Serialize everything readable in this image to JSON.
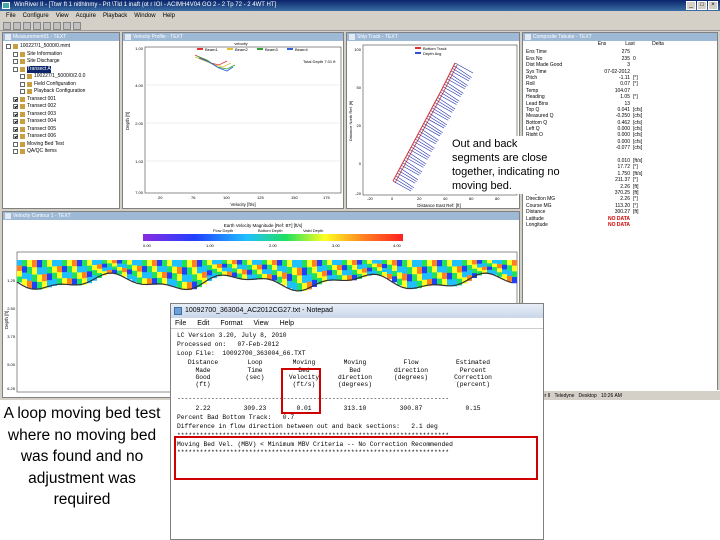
{
  "app": {
    "title": "WinRiver II - [Ttwr ft 1 nitlhlnmy - Prt \\Tld 1 inaft (ot r IOI - ACIMH4V04 GO 2 - 2 Tp 72 - 2 4WT HT]",
    "menu": [
      "File",
      "Configure",
      "View",
      "Acquire",
      "Playback",
      "Window",
      "Help"
    ]
  },
  "tree_pane": {
    "title": "Measurement01 - TEXT",
    "items": [
      {
        "label": "100227/1_5000/0.mmt",
        "checked": false
      },
      {
        "label": "Site Information",
        "checked": false
      },
      {
        "label": "Site Discharge",
        "checked": false
      },
      {
        "label": "Transect A",
        "checked": false,
        "selected": true
      },
      {
        "label": "100227/1_5000/0/2.0.0",
        "checked": false
      },
      {
        "label": "Field Configuration",
        "checked": false
      },
      {
        "label": "Playback Configuration",
        "checked": false
      },
      {
        "label": "Transect 001",
        "checked": true
      },
      {
        "label": "Transect 002",
        "checked": true
      },
      {
        "label": "Transect 003",
        "checked": true
      },
      {
        "label": "Transect 004",
        "checked": true
      },
      {
        "label": "Transect 005",
        "checked": true
      },
      {
        "label": "Transect 006",
        "checked": true
      },
      {
        "label": "Moving Bed Test",
        "checked": false
      },
      {
        "label": "QA/QC Items",
        "checked": false
      }
    ]
  },
  "velocity_pane": {
    "title": "Velocity Profile - TEXT",
    "legend_title": "velocity",
    "legend": [
      "Beam1",
      "Beam2",
      "Beam3",
      "Beam4"
    ],
    "depth_note": "Total Depth 7.01 ft",
    "ylabel": "Depth [ft]",
    "xlabel": "Velocity [ft/s]",
    "yticks": [
      "1.00",
      "4.00",
      "2.00",
      "1.03",
      "7.00"
    ],
    "xticks": [
      "20",
      "76",
      "100",
      "125",
      "150",
      "175"
    ]
  },
  "ship_pane": {
    "title": "Ship Track - TEXT",
    "legend": [
      "Bottom Track",
      "Depth Avg"
    ],
    "ylabel": "Distance North Ref: [ft]",
    "xlabel": "Distance East Ref: [ft]",
    "yticks": [
      "100",
      "50",
      "20",
      "0",
      "-20"
    ],
    "xticks": [
      "-20",
      "0",
      "20",
      "40",
      "60",
      "80"
    ]
  },
  "composite_pane": {
    "title": "Composite Tabular - TEXT",
    "header": [
      "Ens",
      "Last",
      "Delta"
    ],
    "rows": [
      {
        "k": "Ens Time",
        "v": "275",
        "u": ""
      },
      {
        "k": "Ens No",
        "v": "235",
        "u": "0"
      },
      {
        "k": "Dist Made Good",
        "v": "3",
        "u": ""
      },
      {
        "k": "Sys Time",
        "v": "07-02-2012",
        "u": ""
      },
      {
        "k": "Pitch",
        "v": "-1.11",
        "u": "[°]"
      },
      {
        "k": "Roll",
        "v": "0.07",
        "u": "[°]"
      },
      {
        "k": "Temp",
        "v": "104.07",
        "u": ""
      },
      {
        "k": "Heading",
        "v": "1.05",
        "u": "[°]"
      },
      {
        "k": "Lead Bins",
        "v": "13",
        "u": ""
      },
      {
        "k": "Top Q",
        "v": "0.041",
        "u": "[cfs]"
      },
      {
        "k": "Measured Q",
        "v": "-0.250",
        "u": "[cfs]"
      },
      {
        "k": "Bottom Q",
        "v": "0.462",
        "u": "[cfs]"
      },
      {
        "k": "Left Q",
        "v": "0.000",
        "u": "[cfs]"
      },
      {
        "k": "Right Q",
        "v": "0.000",
        "u": "[cfs]"
      },
      {
        "k": "Total Q",
        "v": "0.000",
        "u": "[cfs]"
      },
      {
        "k": "Total Q",
        "v": "-0.077",
        "u": "[cfs]"
      },
      {
        "k": "Navigation",
        "v": "",
        "u": ""
      },
      {
        "k": "Velocity",
        "v": "0.010",
        "u": "[ft/s]"
      },
      {
        "k": "Direction",
        "v": "17.72",
        "u": "[°]"
      },
      {
        "k": "Flow Speed",
        "v": "1.750",
        "u": "[ft/s]"
      },
      {
        "k": "Flow Dir",
        "v": "211.37",
        "u": "[°]"
      },
      {
        "k": "Coll. Depth",
        "v": "2.26",
        "u": "[ft]"
      },
      {
        "k": "Length",
        "v": "370.25",
        "u": "[ft]"
      },
      {
        "k": "Direction MG",
        "v": "2.26",
        "u": "[°]"
      },
      {
        "k": "Course MG",
        "v": "113.20",
        "u": "[°]"
      },
      {
        "k": "Distance",
        "v": "300.27",
        "u": "[ft]"
      },
      {
        "k": "Latitude",
        "v": "NO DATA",
        "u": "",
        "red": true
      },
      {
        "k": "Longitude",
        "v": "NO DATA",
        "u": "",
        "red": true
      }
    ]
  },
  "contour_pane": {
    "title": "Velocity Contour 1 - TEXT",
    "colorbar_title": "Earth Velocity Magnitude [Ref: BT] [ft/s]",
    "colorbar_labels": [
      "Flow Depth",
      "Bottom Depth",
      "Valid Depth"
    ],
    "colorbar_ticks": [
      "0.00",
      "1.00",
      "2.00",
      "3.00",
      "4.00"
    ],
    "ylabel": "Depth [ft]",
    "yticks": [
      "1.25",
      "2.50",
      "3.75",
      "5.00",
      "6.25"
    ]
  },
  "taskbar": {
    "items": [
      "WinRiver II",
      "Teledyne",
      "Desktop",
      "10:26 AM"
    ]
  },
  "callout": "Out and back segments are close together, indicating no moving bed.",
  "caption": "A loop moving bed test where no moving bed was found and no adjustment was required",
  "notepad": {
    "title": "10092700_363004_AC2012CG27.txt - Notepad",
    "menu": [
      "File",
      "Edit",
      "Format",
      "View",
      "Help"
    ],
    "lines": [
      "LC Version 3.20, July 8, 2010",
      "Processed on:   07-Feb-2012",
      "Loop File:  10092700_363004_66.TXT"
    ],
    "columns": [
      {
        "header": "Distance\nMade\nGood\n(ft)",
        "value": "2.22"
      },
      {
        "header": "Loop\nTime\n(sec)",
        "value": "309.23"
      },
      {
        "header": "Moving\nBed\nVelocity\n(ft/s)",
        "value": "0.01"
      },
      {
        "header": "Moving\nBed\ndirection\n(degrees)",
        "value": "313.10"
      },
      {
        "header": "Flow\ndirection\n(degrees)",
        "value": "300.87"
      },
      {
        "header": "Estimated\nPercent\nCorrection\n(percent)",
        "value": "0.15"
      }
    ],
    "rule": "------------------------------------------------------------------------",
    "bottom_track_line": "Percent Bad Bottom Track:   0.7",
    "difference_line": "Difference in flow direction between out and back sections:   2.1 deg",
    "stars": "************************************************************************",
    "result_line": "Moving Bed Vel. (MBV) < Minimum MBV Criteria -- No Correction Recommended"
  }
}
